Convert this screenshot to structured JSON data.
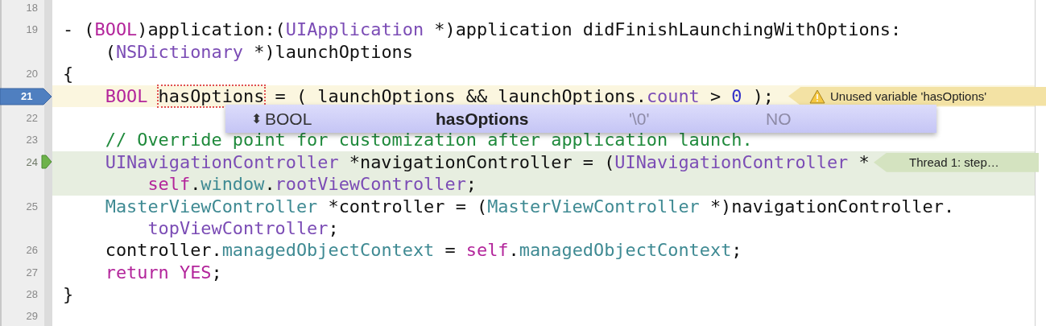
{
  "editor": {
    "lines": [
      {
        "number": "18",
        "breakpoint": false,
        "warning": false,
        "current": false
      },
      {
        "number": "19",
        "breakpoint": false,
        "warning": false,
        "current": false,
        "rows": [
          {
            "kind": "outer",
            "parts": [
              {
                "t": "- (",
                "color": "#111111"
              },
              {
                "t": "BOOL",
                "color": "#b3259b"
              },
              {
                "t": ")application:(",
                "color": "#111111"
              },
              {
                "t": "UIApplication",
                "color": "#7b4cb5"
              },
              {
                "t": " *)application didFinishLaunchingWithOptions:",
                "color": "#111111"
              }
            ]
          },
          {
            "kind": "outer-wrap",
            "parts": [
              {
                "t": "(",
                "color": "#111111"
              },
              {
                "t": "NSDictionary",
                "color": "#7b4cb5"
              },
              {
                "t": " *)launchOptions",
                "color": "#111111"
              }
            ]
          }
        ]
      },
      {
        "number": "20",
        "breakpoint": false,
        "warning": false,
        "current": false,
        "rows": [
          {
            "kind": "outer",
            "parts": [
              {
                "t": "{",
                "color": "#111111"
              }
            ]
          }
        ]
      },
      {
        "number": "21",
        "breakpoint": true,
        "warning": true,
        "current": false,
        "rows": [
          {
            "kind": "inner",
            "parts": [
              {
                "t": "BOOL ",
                "color": "#b3259b"
              },
              {
                "t": "hasOptions",
                "color": "#111111",
                "issue": true
              },
              {
                "t": " = ( launchOptions && launchOptions.",
                "color": "#111111"
              },
              {
                "t": "count",
                "color": "#7b4cb5"
              },
              {
                "t": " > ",
                "color": "#111111"
              },
              {
                "t": "0",
                "color": "#3431c8"
              },
              {
                "t": " );",
                "color": "#111111"
              }
            ]
          }
        ],
        "annotation": {
          "kind": "warning",
          "text": "Unused variable 'hasOptions'"
        }
      },
      {
        "number": "22",
        "breakpoint": false,
        "warning": false,
        "current": false
      },
      {
        "number": "23",
        "breakpoint": false,
        "warning": false,
        "current": false,
        "rows": [
          {
            "kind": "inner",
            "parts": [
              {
                "t": "// Override point for customization after application launch.",
                "color": "#1f8a3c"
              }
            ]
          }
        ]
      },
      {
        "number": "24",
        "breakpoint": false,
        "warning": false,
        "current": true,
        "rows": [
          {
            "kind": "inner",
            "parts": [
              {
                "t": "UINavigationController",
                "color": "#7b4cb5"
              },
              {
                "t": " *navigationController = (",
                "color": "#111111"
              },
              {
                "t": "UINavigationController",
                "color": "#7b4cb5"
              },
              {
                "t": " *",
                "color": "#111111"
              }
            ]
          },
          {
            "kind": "inner-wrap",
            "parts": [
              {
                "t": "self",
                "color": "#b3259b"
              },
              {
                "t": ".",
                "color": "#111111"
              },
              {
                "t": "window",
                "color": "#3f8a93"
              },
              {
                "t": ".",
                "color": "#111111"
              },
              {
                "t": "rootViewController",
                "color": "#7b4cb5"
              },
              {
                "t": ";",
                "color": "#111111"
              }
            ]
          }
        ],
        "annotation": {
          "kind": "thread",
          "text": "Thread 1: step…"
        }
      },
      {
        "number": "25",
        "breakpoint": false,
        "warning": false,
        "current": false,
        "rows": [
          {
            "kind": "inner",
            "parts": [
              {
                "t": "MasterViewController",
                "color": "#3f8a93"
              },
              {
                "t": " *controller = (",
                "color": "#111111"
              },
              {
                "t": "MasterViewController",
                "color": "#3f8a93"
              },
              {
                "t": " *)navigationController.",
                "color": "#111111"
              }
            ]
          },
          {
            "kind": "inner-wrap",
            "parts": [
              {
                "t": "topViewController",
                "color": "#7b4cb5"
              },
              {
                "t": ";",
                "color": "#111111"
              }
            ]
          }
        ]
      },
      {
        "number": "26",
        "breakpoint": false,
        "warning": false,
        "current": false,
        "rows": [
          {
            "kind": "inner",
            "parts": [
              {
                "t": "controller.",
                "color": "#111111"
              },
              {
                "t": "managedObjectContext",
                "color": "#3f8a93"
              },
              {
                "t": " = ",
                "color": "#111111"
              },
              {
                "t": "self",
                "color": "#b3259b"
              },
              {
                "t": ".",
                "color": "#111111"
              },
              {
                "t": "managedObjectContext",
                "color": "#3f8a93"
              },
              {
                "t": ";",
                "color": "#111111"
              }
            ]
          }
        ]
      },
      {
        "number": "27",
        "breakpoint": false,
        "warning": false,
        "current": false,
        "rows": [
          {
            "kind": "inner",
            "parts": [
              {
                "t": "return ",
                "color": "#b3259b"
              },
              {
                "t": "YES",
                "color": "#b3259b"
              },
              {
                "t": ";",
                "color": "#111111"
              }
            ]
          }
        ]
      },
      {
        "number": "28",
        "breakpoint": false,
        "warning": false,
        "current": false,
        "rows": [
          {
            "kind": "outer",
            "parts": [
              {
                "t": "}",
                "color": "#111111"
              }
            ]
          }
        ]
      },
      {
        "number": "29",
        "breakpoint": false,
        "warning": false,
        "current": false
      }
    ],
    "data_tip": {
      "stepper": "⬍",
      "type": "BOOL",
      "name": "hasOptions",
      "character": "'\\0'",
      "value": "NO"
    }
  }
}
